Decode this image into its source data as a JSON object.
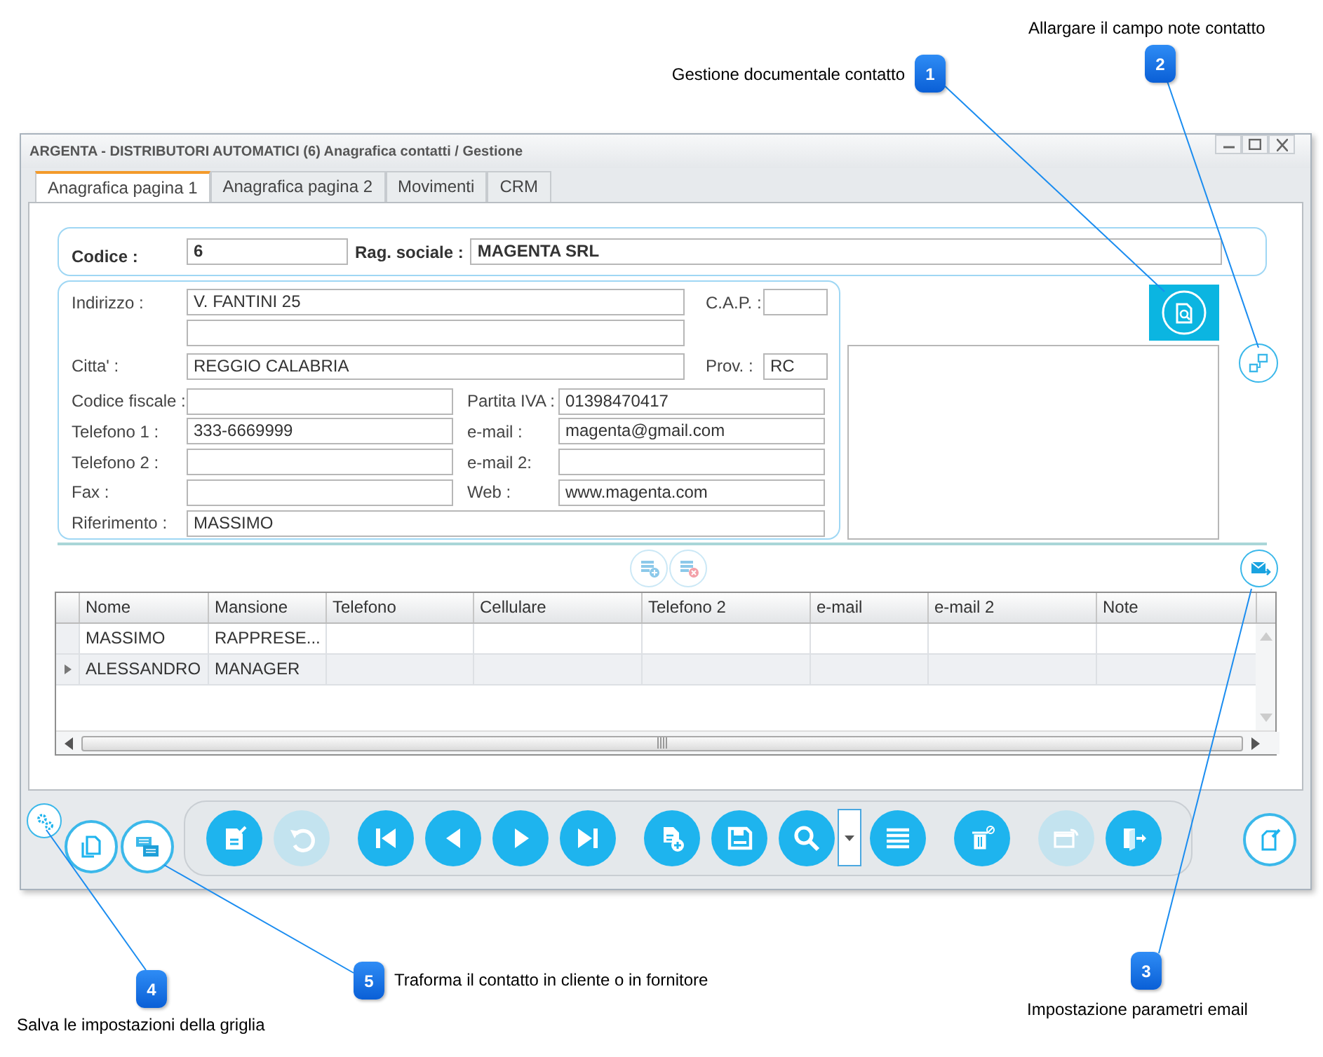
{
  "window": {
    "title": "ARGENTA - DISTRIBUTORI AUTOMATICI (6) Anagrafica contatti / Gestione"
  },
  "tabs": [
    {
      "label": "Anagrafica pagina 1",
      "selected": true
    },
    {
      "label": "Anagrafica pagina 2",
      "selected": false
    },
    {
      "label": "Movimenti",
      "selected": false
    },
    {
      "label": "CRM",
      "selected": false
    }
  ],
  "header": [
    {
      "label": "Codice :",
      "value": "6"
    },
    {
      "label": "Rag. sociale :",
      "value": "MAGENTA SRL"
    }
  ],
  "address_rows": [
    {
      "kind": "pair-short",
      "items": [
        {
          "label": "Indirizzo :",
          "value": "V. FANTINI 25"
        },
        {
          "label": "C.A.P. :"
        }
      ]
    },
    {
      "kind": "blank"
    },
    {
      "kind": "pair-short",
      "items": [
        {
          "label": "Citta' :",
          "value": "REGGIO CALABRIA"
        },
        {
          "label": "Prov. :",
          "value": "RC"
        }
      ]
    },
    {
      "kind": "pair",
      "items": [
        {
          "label": "Codice fiscale :"
        },
        {
          "label": "Partita IVA :",
          "value": "01398470417"
        }
      ]
    },
    {
      "kind": "pair",
      "items": [
        {
          "label": "Telefono 1 :",
          "value": "333-6669999"
        },
        {
          "label": "e-mail :",
          "value": "magenta@gmail.com"
        }
      ]
    },
    {
      "kind": "pair",
      "items": [
        {
          "label": "Telefono 2 :"
        },
        {
          "label": "e-mail 2:"
        }
      ]
    },
    {
      "kind": "pair",
      "items": [
        {
          "label": "Fax :"
        },
        {
          "label": "Web :",
          "value": "www.magenta.com"
        }
      ]
    },
    {
      "kind": "single",
      "items": [
        {
          "label": "Riferimento :",
          "value": "MASSIMO"
        }
      ]
    }
  ],
  "contacts_grid": {
    "columns": [
      "Nome",
      "Mansione",
      "Telefono",
      "Cellulare",
      "Telefono 2",
      "e-mail",
      "e-mail 2",
      "Note"
    ],
    "rows": [
      {
        "cells": [
          "MASSIMO",
          "RAPPRESE..."
        ],
        "selected": false
      },
      {
        "cells": [
          "ALESSANDRO",
          "MANAGER"
        ],
        "selected": true
      }
    ]
  },
  "toolbar": {
    "groups": [
      [
        {
          "kind": "edit",
          "disabled": false
        },
        {
          "kind": "undo",
          "disabled": true
        }
      ],
      [
        {
          "kind": "first",
          "disabled": false
        },
        {
          "kind": "prev",
          "disabled": false
        },
        {
          "kind": "next",
          "disabled": false
        },
        {
          "kind": "last",
          "disabled": false
        }
      ],
      [
        {
          "kind": "new",
          "disabled": false
        },
        {
          "kind": "save",
          "disabled": false
        },
        {
          "kind": "search",
          "disabled": false
        },
        {
          "kind": "dropdown"
        },
        {
          "kind": "list",
          "disabled": false
        }
      ],
      [
        {
          "kind": "delete",
          "disabled": false
        }
      ],
      [
        {
          "kind": "window",
          "disabled": true
        },
        {
          "kind": "exit",
          "disabled": false
        }
      ]
    ]
  },
  "callouts": [
    {
      "number": "1",
      "text": "Gestione documentale contatto"
    },
    {
      "number": "2",
      "text": "Allargare il campo note contatto"
    },
    {
      "number": "3",
      "text": "Impostazione parametri email"
    },
    {
      "number": "4",
      "text": "Salva le impostazioni della griglia"
    },
    {
      "number": "5",
      "text": "Traforma il contatto in cliente o in fornitore"
    }
  ]
}
